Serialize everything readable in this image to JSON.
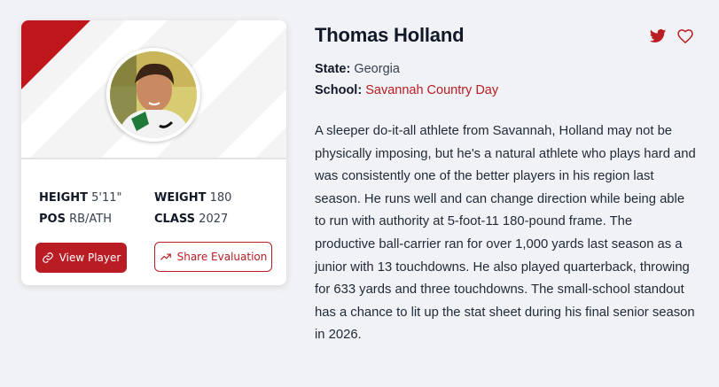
{
  "player": {
    "name": "Thomas Holland",
    "state_label": "State:",
    "state": "Georgia",
    "school_label": "School:",
    "school": "Savannah Country Day",
    "bio": "A sleeper do-it-all athlete from Savannah, Holland may not be physically imposing, but he's a natural athlete who plays hard and was consistently one of the better players in his region last season. He runs well and can change direction while being able to run with authority at 5-foot-11 180-pound frame. The productive ball-carrier ran for over 1,000 yards last season as a junior with 13 touchdowns. He also played quarterback, throwing for 633 yards and three touchdowns. The small-school standout has a chance to lit up the stat sheet during his final senior season in 2026."
  },
  "stats": {
    "height_label": "HEIGHT",
    "height": "5'11\"",
    "weight_label": "WEIGHT",
    "weight": "180",
    "pos_label": "POS",
    "pos": "RB/ATH",
    "class_label": "CLASS",
    "class": "2027"
  },
  "buttons": {
    "view_player": "View Player",
    "share_evaluation": "Share Evaluation"
  },
  "icons": {
    "link": "link-icon",
    "share": "trending-arrow-icon",
    "twitter": "twitter-icon",
    "favorite": "heart-icon"
  },
  "colors": {
    "accent": "#b91c22",
    "background": "#f1f2f5",
    "card": "#ffffff"
  }
}
